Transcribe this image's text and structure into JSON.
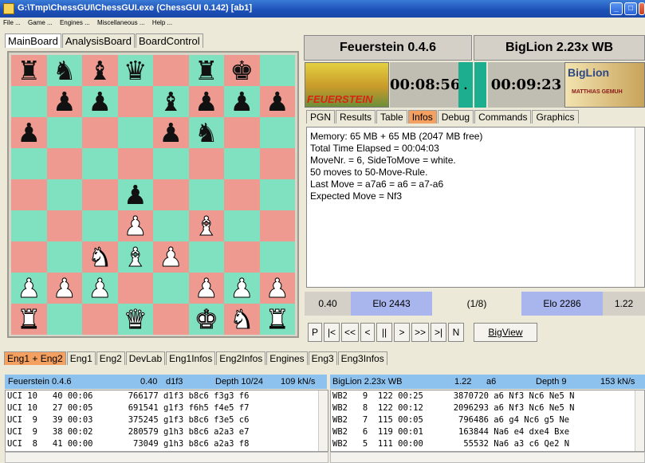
{
  "window": {
    "title": "G:\\Tmp\\ChessGUI\\ChessGUI.exe (ChessGUI 0.142) [ab1]"
  },
  "menu": [
    "File ...",
    "Game ...",
    "Engines ...",
    "Miscellaneous ...",
    "Help ..."
  ],
  "left_tabs": [
    "MainBoard",
    "AnalysisBoard",
    "BoardControl"
  ],
  "board": {
    "ranks": [
      [
        "bR",
        "bN",
        "bB",
        "bQ",
        "",
        "bR",
        "bK",
        ""
      ],
      [
        "",
        "bP",
        "bP",
        "",
        "bB",
        "bP",
        "bP",
        "bP"
      ],
      [
        "bP",
        "",
        "",
        "",
        "bP",
        "bN",
        "",
        ""
      ],
      [
        "",
        "",
        "",
        "",
        "",
        "",
        "",
        ""
      ],
      [
        "",
        "",
        "",
        "bP",
        "",
        "",
        "",
        ""
      ],
      [
        "",
        "",
        "",
        "wP",
        "",
        "wB",
        "",
        ""
      ],
      [
        "",
        "",
        "wN",
        "wB",
        "wP",
        "",
        "",
        ""
      ],
      [
        "wP",
        "wP",
        "wP",
        "",
        "",
        "wP",
        "wP",
        "wP"
      ],
      [
        "wR",
        "",
        "",
        "wQ",
        "",
        "wK",
        "wN",
        "wR"
      ]
    ]
  },
  "players": {
    "white": "Feuerstein 0.4.6",
    "black": "BigLion 2.23x WB"
  },
  "logos": {
    "white": "FEUERSTEIN",
    "black": "BigLion",
    "black_sub": "MATTHIAS GEMUH"
  },
  "clocks": {
    "white": "00:08:56",
    "black": "00:09:23",
    "indicator": "."
  },
  "info_tabs": [
    "PGN",
    "Results",
    "Table",
    "Infos",
    "Debug",
    "Commands",
    "Graphics"
  ],
  "info_lines": [
    "Memory: 65 MB + 65 MB (2047 MB free)",
    "Total Time Elapsed = 00:04:03",
    "MoveNr. = 6, SideToMove = white.",
    "50 moves to 50-Move-Rule.",
    "Last Move = a7a6 = a6 = a7-a6",
    "Expected Move = Nf3"
  ],
  "elo_bar": {
    "eval_white": "0.40",
    "elo_white": "Elo 2443",
    "progress": "(1/8)",
    "elo_black": "Elo 2286",
    "eval_black": "1.22"
  },
  "nav": [
    "P",
    "|<",
    "<<",
    "<",
    "||",
    ">",
    ">>",
    ">|",
    "N"
  ],
  "bigview": "BigView",
  "bottom_tabs": [
    "Eng1 + Eng2",
    "Eng1",
    "Eng2",
    "DevLab",
    "Eng1Infos",
    "Eng2Infos",
    "Engines",
    "Eng3",
    "Eng3Infos"
  ],
  "engine1": {
    "header": {
      "name": "Feuerstein 0.4.6",
      "eval": "0.40",
      "move": "d1f3",
      "depth": "Depth 10/24",
      "speed": "109 kN/s"
    },
    "rows": [
      "UCI 10   40 00:06       766177 d1f3 b8c6 f3g3 f6",
      "UCI 10   27 00:05       691541 g1f3 f6h5 f4e5 f7",
      "UCI  9   39 00:03       375245 g1f3 b8c6 f3e5 c6",
      "UCI  9   38 00:02       280579 g1h3 b8c6 a2a3 e7",
      "UCI  8   41 00:00        73049 g1h3 b8c6 a2a3 f8"
    ]
  },
  "engine2": {
    "header": {
      "name": "BigLion 2.23x WB",
      "eval": "1.22",
      "move": "a6",
      "depth": "Depth 9",
      "speed": "153 kN/s"
    },
    "rows": [
      "WB2   9  122 00:25      3870720 a6 Nf3 Nc6 Ne5 N",
      "WB2   8  122 00:12      2096293 a6 Nf3 Nc6 Ne5 N",
      "WB2   7  115 00:05       796486 a6 g4 Nc6 g5 Ne",
      "WB2   6  119 00:01       163844 Na6 e4 dxe4 Bxe",
      "WB2   5  111 00:00        55532 Na6 a3 c6 Qe2 N"
    ]
  }
}
